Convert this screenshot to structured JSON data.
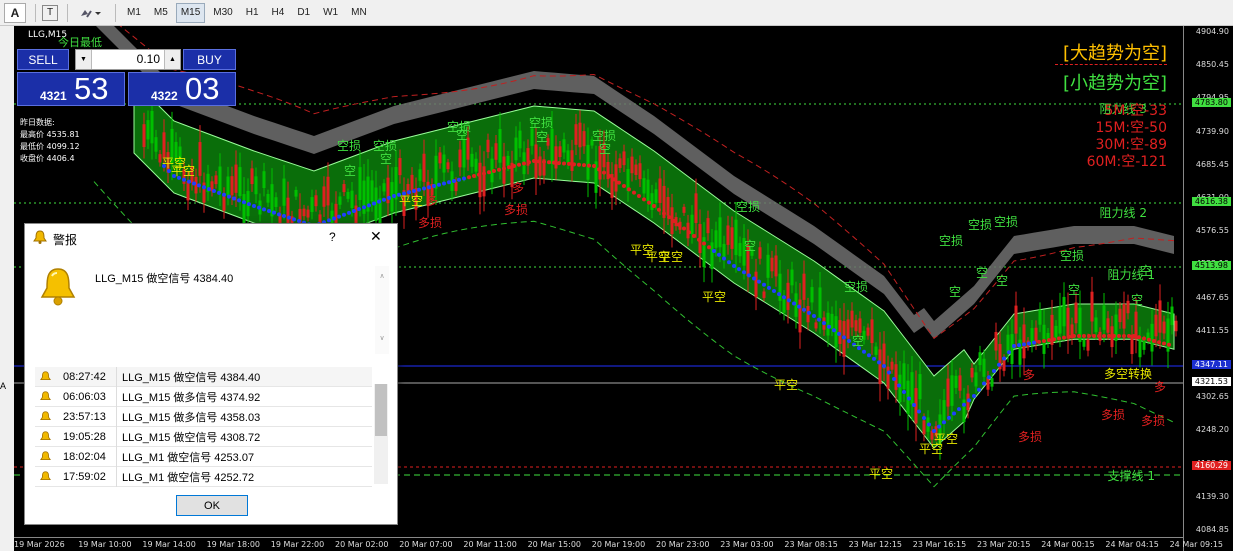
{
  "toolbar": {
    "text_tool": "A",
    "text_label_tool": "T",
    "timeframes": [
      "M1",
      "M5",
      "M15",
      "M30",
      "H1",
      "H4",
      "D1",
      "W1",
      "MN"
    ],
    "active_timeframe": "M15"
  },
  "chart": {
    "symbol": "LLG,M15",
    "overlay_label": "今日最低",
    "trade_panel": {
      "sell_label": "SELL",
      "buy_label": "BUY",
      "lot": "0.10",
      "sell_price_small": "4321",
      "sell_price_big": "53",
      "buy_price_small": "4322",
      "buy_price_big": "03"
    },
    "yesterday": {
      "title": "昨日数据:",
      "high": "最高价 4535.81",
      "low": "最低价 4099.12",
      "close": "收盘价 4406.4"
    },
    "trend": {
      "big": "[大趋势为空]",
      "small": "[小趋势为空]"
    },
    "tf_status": [
      "5M:空-33",
      "15M:空-50",
      "30M:空-89",
      "60M:空-121"
    ],
    "levels": {
      "resistance3": "阻力线 3",
      "resistance2": "阻力线 2",
      "resistance1": "阻力线 1",
      "support1": "支撑线 1"
    },
    "y_axis": [
      "4904.90",
      "4850.45",
      "4794.95",
      "4739.90",
      "4685.45",
      "4631.00",
      "4576.55",
      "4522.10",
      "4467.65",
      "4411.55",
      "4357.10",
      "4302.65",
      "4248.20",
      "4193.75",
      "4139.30",
      "4084.85"
    ],
    "y_boxes": {
      "r3": "4783.80",
      "r2": "4616.38",
      "r1": "4513.98",
      "bid_blue": "4347.11",
      "bid": "4321.53",
      "s1": "4160.29"
    },
    "x_axis": [
      "19 Mar 2026",
      "19 Mar 10:00",
      "19 Mar 14:00",
      "19 Mar 18:00",
      "19 Mar 22:00",
      "20 Mar 02:00",
      "20 Mar 07:00",
      "20 Mar 11:00",
      "20 Mar 15:00",
      "20 Mar 19:00",
      "20 Mar 23:00",
      "23 Mar 03:00",
      "23 Mar 08:15",
      "23 Mar 12:15",
      "23 Mar 16:15",
      "23 Mar 20:15",
      "24 Mar 00:15",
      "24 Mar 04:15",
      "24 Mar 09:15"
    ],
    "signal_labels": {
      "kong": "空",
      "kong_sun": "空损",
      "duo": "多",
      "duo_sun": "多损",
      "ping_kong": "平空",
      "zhuan_duo": "多空转换"
    },
    "colors": {
      "bull_candle": "#00c000",
      "bear_candle": "#e02020",
      "band_green": "#0a6e0a",
      "band_grey": "#a0a0a0",
      "resistance": "#e8e800",
      "support": "#e02020"
    }
  },
  "alert_dialog": {
    "title": "警报",
    "help": "?",
    "close": "✕",
    "current_message": "LLG_M15 做空信号 4384.40",
    "history": [
      {
        "time": "08:27:42",
        "msg": "LLG_M15 做空信号 4384.40"
      },
      {
        "time": "06:06:03",
        "msg": "LLG_M15 做多信号 4374.92"
      },
      {
        "time": "23:57:13",
        "msg": "LLG_M15 做多信号 4358.03"
      },
      {
        "time": "19:05:28",
        "msg": "LLG_M15 做空信号 4308.72"
      },
      {
        "time": "18:02:04",
        "msg": "LLG_M1 做空信号 4253.07"
      },
      {
        "time": "17:59:02",
        "msg": "LLG_M1 做空信号 4252.72"
      }
    ],
    "ok_label": "OK"
  }
}
